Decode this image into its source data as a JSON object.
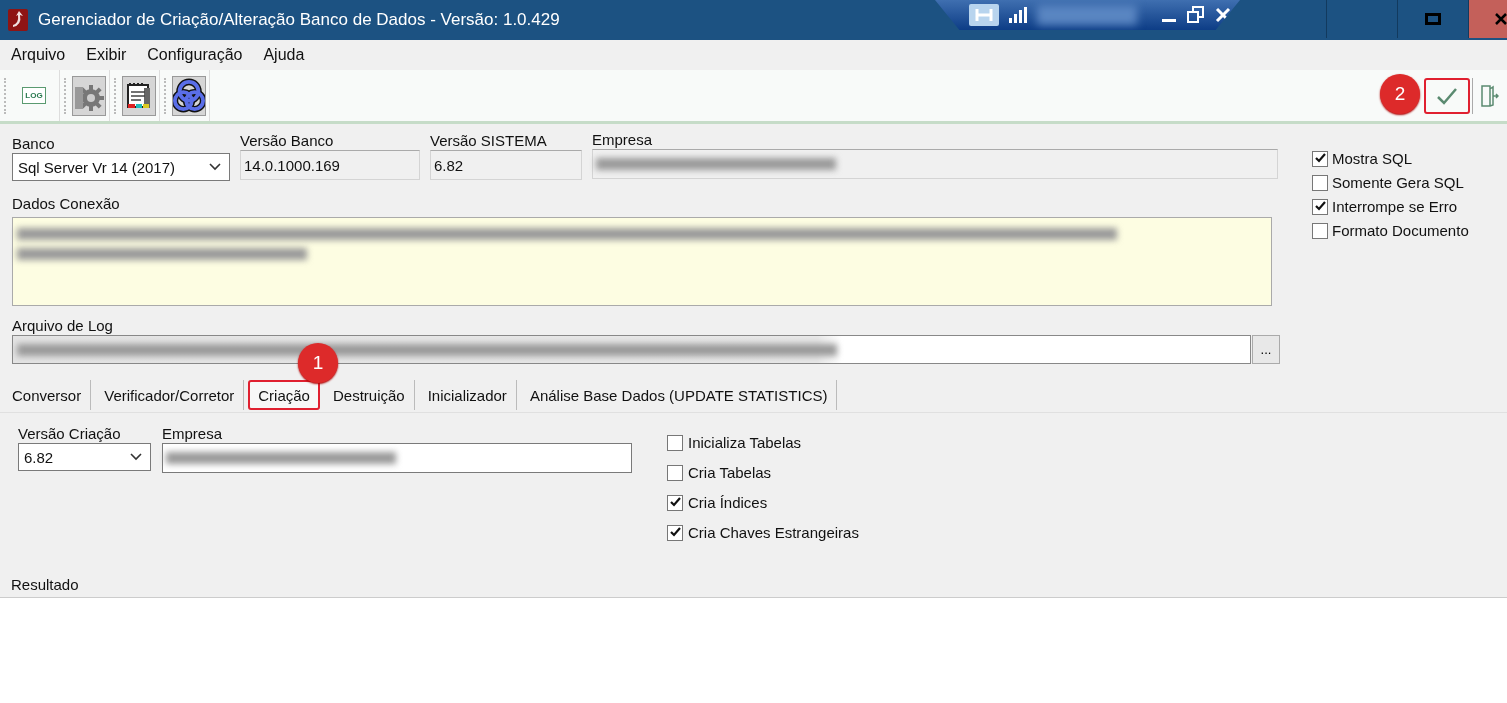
{
  "window": {
    "title": "Gerenciador de Criação/Alteração Banco de Dados - Versão: 1.0.429"
  },
  "menu": [
    {
      "label": "Arquivo"
    },
    {
      "label": "Exibir"
    },
    {
      "label": "Configuração"
    },
    {
      "label": "Ajuda"
    }
  ],
  "toolbar": {
    "log_icon_text": "LOG",
    "confirm_highlighted": true
  },
  "connection": {
    "banco": {
      "label": "Banco",
      "value": "Sql Server Vr 14 (2017)"
    },
    "versao_banco": {
      "label": "Versão Banco",
      "value": "14.0.1000.169"
    },
    "versao_sistema": {
      "label": "Versão SISTEMA",
      "value": "6.82"
    },
    "empresa": {
      "label": "Empresa"
    },
    "dados_conexao": {
      "label": "Dados Conexão"
    },
    "arquivo_log": {
      "label": "Arquivo de Log",
      "button": "..."
    }
  },
  "options": [
    {
      "label": "Mostra SQL",
      "checked": true
    },
    {
      "label": "Somente Gera SQL",
      "checked": false
    },
    {
      "label": "Interrompe se Erro",
      "checked": true
    },
    {
      "label": "Formato Documento",
      "checked": false
    }
  ],
  "tabs": [
    {
      "label": "Conversor",
      "selected": false
    },
    {
      "label": "Verificador/Corretor",
      "selected": false
    },
    {
      "label": "Criação",
      "selected": true
    },
    {
      "label": "Destruição",
      "selected": false
    },
    {
      "label": "Inicializador",
      "selected": false
    },
    {
      "label": "Análise Base Dados (UPDATE STATISTICS)",
      "selected": false
    }
  ],
  "creation": {
    "versao": {
      "label": "Versão Criação",
      "value": "6.82"
    },
    "empresa": {
      "label": "Empresa"
    },
    "options": [
      {
        "label": "Inicializa Tabelas",
        "checked": false
      },
      {
        "label": "Cria Tabelas",
        "checked": false
      },
      {
        "label": "Cria Índices",
        "checked": true
      },
      {
        "label": "Cria Chaves Estrangeiras",
        "checked": true
      }
    ]
  },
  "result": {
    "label": "Resultado"
  },
  "annotations": [
    {
      "number": "1"
    },
    {
      "number": "2"
    }
  ]
}
